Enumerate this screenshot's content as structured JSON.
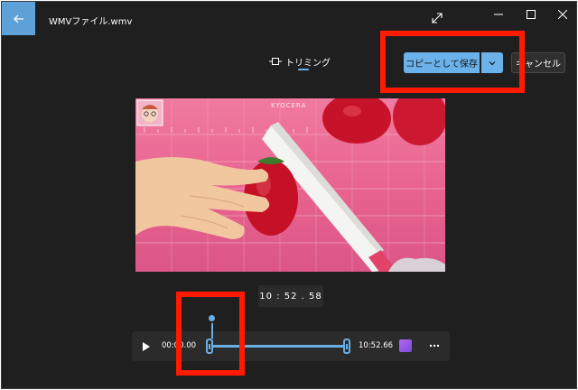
{
  "window": {
    "title": "WMVファイル.wmv"
  },
  "toolbar": {
    "tab_label": "トリミング",
    "save_label": "コピーとして保存",
    "cancel_label": "キャンセル"
  },
  "video": {
    "watermark_text": "KYOCERA"
  },
  "timeline": {
    "current_time": "10 : 52 . 58",
    "start_time": "00:00.00",
    "end_time": "10:52.66",
    "trim_start_fraction": 0.0,
    "trim_end_fraction": 1.0,
    "playhead_fraction": 0.0
  },
  "colors": {
    "accent": "#6cb2ea",
    "highlight": "#ff1a00",
    "background": "#1f1f1f"
  }
}
